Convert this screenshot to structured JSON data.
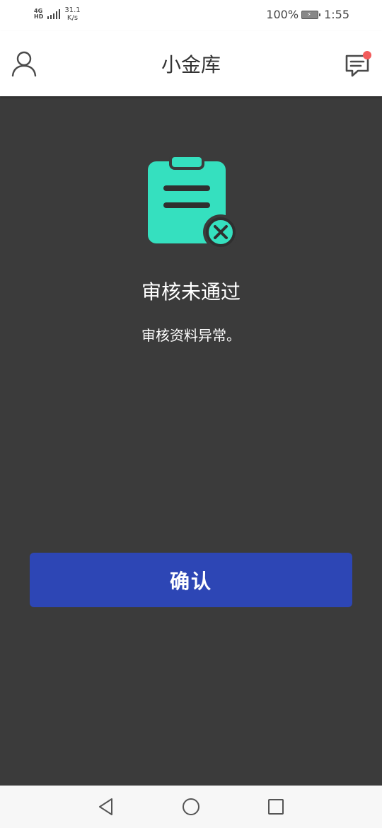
{
  "status_bar": {
    "network_type": "4G",
    "network_sub": "HD",
    "speed_value": "31.1",
    "speed_unit": "K/s",
    "battery_percent": "100%",
    "time": "1:55"
  },
  "header": {
    "title": "小金库",
    "user_icon": "user-icon",
    "message_icon": "message-icon",
    "has_unread": true
  },
  "result": {
    "icon": "clipboard-rejected-icon",
    "title": "审核未通过",
    "description": "审核资料异常。"
  },
  "actions": {
    "confirm_label": "确认"
  },
  "nav": {
    "back_icon": "back-triangle-icon",
    "home_icon": "home-circle-icon",
    "recent_icon": "recent-square-icon"
  },
  "colors": {
    "background": "#3b3b3b",
    "accent": "#2d46b5",
    "icon_teal": "#35e0bf",
    "badge_red": "#f25b5b"
  }
}
